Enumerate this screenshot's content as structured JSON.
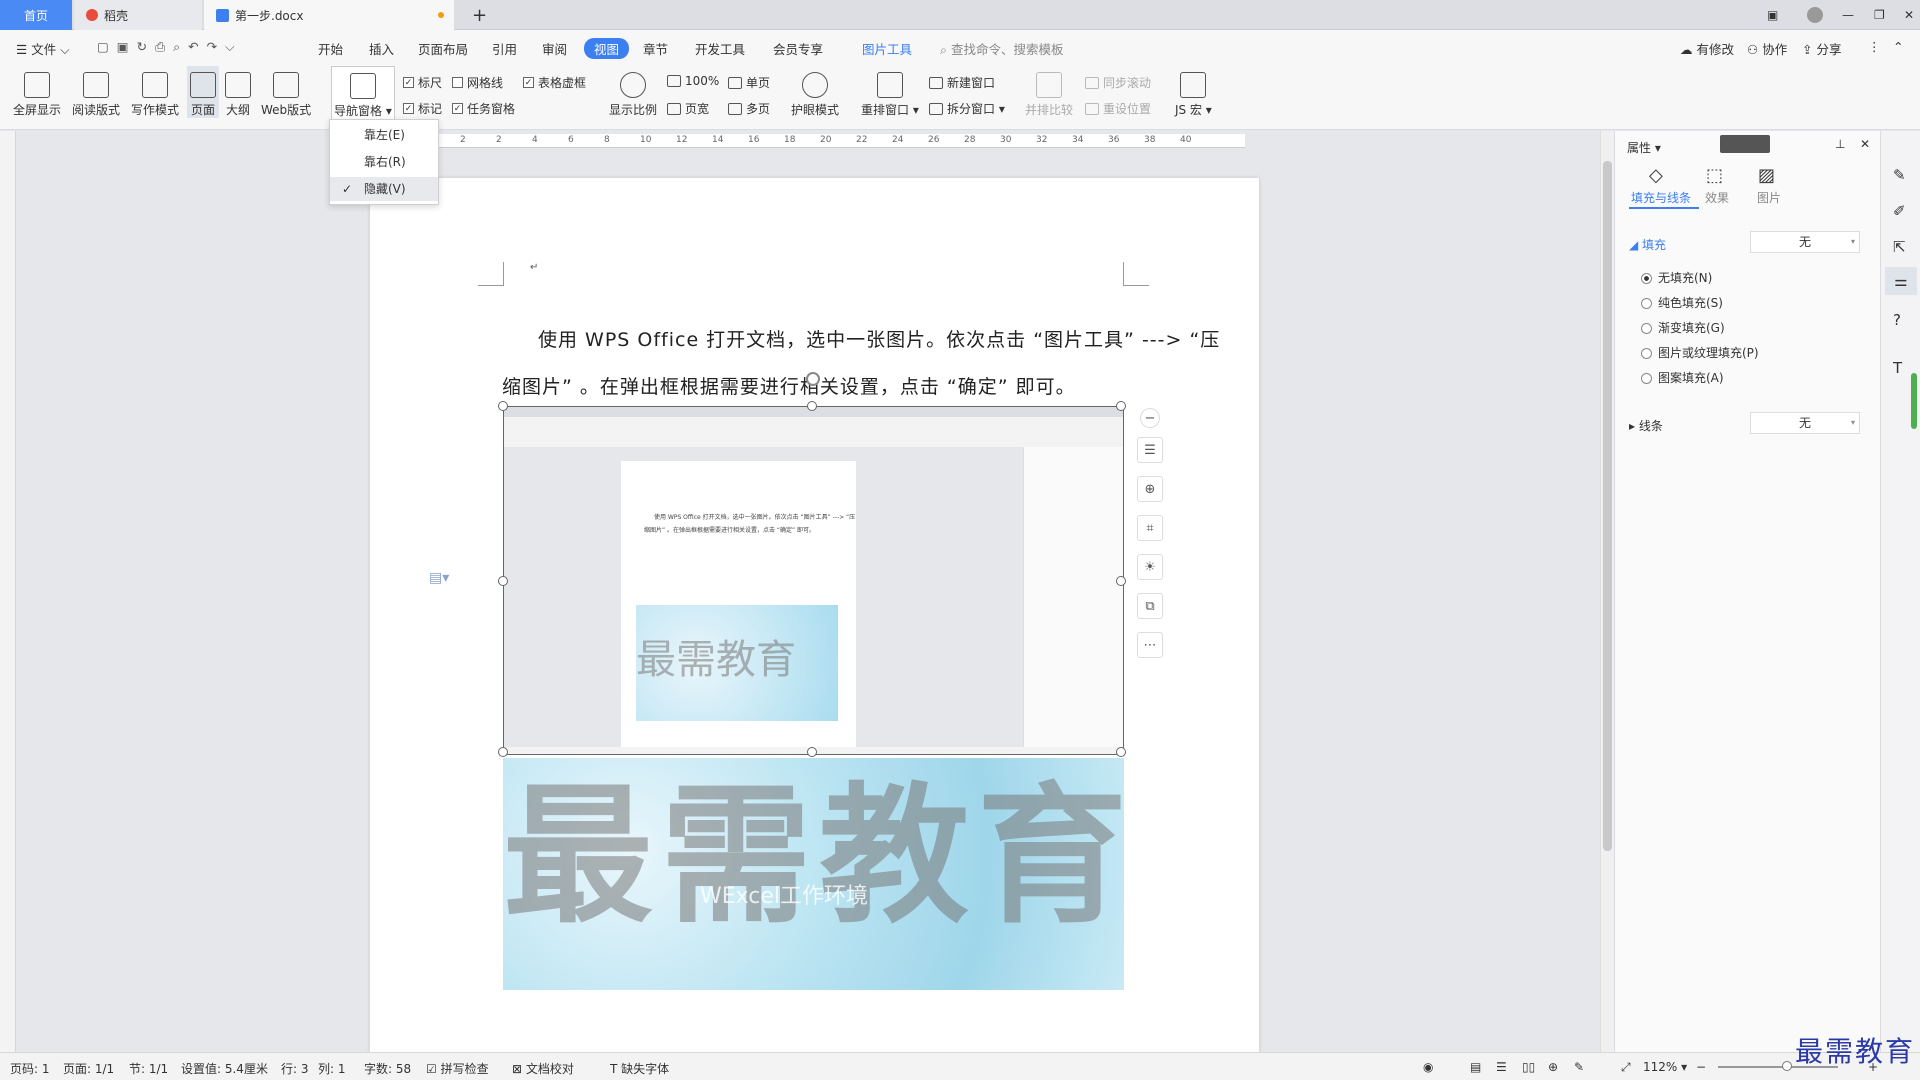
{
  "tabs": {
    "home": "首页",
    "daoke": "稻壳",
    "doc": "第一步.docx",
    "add": "+"
  },
  "menu": {
    "file": "文件",
    "items": [
      "开始",
      "插入",
      "页面布局",
      "引用",
      "审阅",
      "视图",
      "章节",
      "开发工具",
      "会员专享",
      "图片工具"
    ],
    "search": "查找命令、搜索模板",
    "right": [
      "有修改",
      "协作",
      "分享"
    ]
  },
  "ribbon": {
    "fullscreen": "全屏显示",
    "read": "阅读版式",
    "write": "写作模式",
    "page": "页面",
    "outline": "大纲",
    "web": "Web版式",
    "nav": "导航窗格",
    "ruler": "标尺",
    "grid": "网格线",
    "tablegrid": "表格虚框",
    "mark": "标记",
    "taskpane": "任务窗格",
    "zoom": "显示比例",
    "zoom100": "100%",
    "single": "单页",
    "pagewidth": "页宽",
    "multi": "多页",
    "eye": "护眼模式",
    "rearrange": "重排窗口",
    "newwin": "新建窗口",
    "split": "拆分窗口",
    "sidebyside": "并排比较",
    "syncscroll": "同步滚动",
    "resetpos": "重设位置",
    "macro": "JS 宏"
  },
  "dropdown": {
    "left": "靠左(E)",
    "right": "靠右(R)",
    "hide": "隐藏(V)"
  },
  "ruler_ticks": [
    "2",
    "2",
    "4",
    "6",
    "8",
    "10",
    "12",
    "14",
    "16",
    "18",
    "20",
    "22",
    "24",
    "26",
    "28",
    "30",
    "32",
    "34",
    "36",
    "38",
    "40"
  ],
  "doc": {
    "para_mark": "↵",
    "line1": "使用 WPS Office 打开文档，选中一张图片。依次点击 “图片工具” ---> “压",
    "line2": "缩图片” 。在弹出框根据需要进行相关设置，点击 “确定” 即可。",
    "watermark_big": "最需教育",
    "watermark_small": "WExcel工作环境",
    "inner_watermark": "最需教育",
    "inner_line1": "使用 WPS Office 打开文档，选中一张图片。依次点击 “图片工具” ---> “压",
    "inner_line2": "缩图片” 。在弹出框根据需要进行相关设置，点击 “确定” 即可。"
  },
  "panel": {
    "title": "属性",
    "tabs": [
      "填充与线条",
      "效果",
      "图片"
    ],
    "fill": "填充",
    "fill_value": "无",
    "options": [
      "无填充(N)",
      "纯色填充(S)",
      "渐变填充(G)",
      "图片或纹理填充(P)",
      "图案填充(A)"
    ],
    "line": "线条",
    "line_value": "无"
  },
  "status": {
    "page": "页码: 1",
    "pages": "页面: 1/1",
    "section": "节: 1/1",
    "setting": "设置值: 5.4厘米",
    "row": "行: 3",
    "col": "列: 1",
    "words": "字数: 58",
    "spell": "拼写检查",
    "proof": "文档校对",
    "font": "缺失字体",
    "zoom": "112%"
  },
  "watermark_corner": "最需教育"
}
